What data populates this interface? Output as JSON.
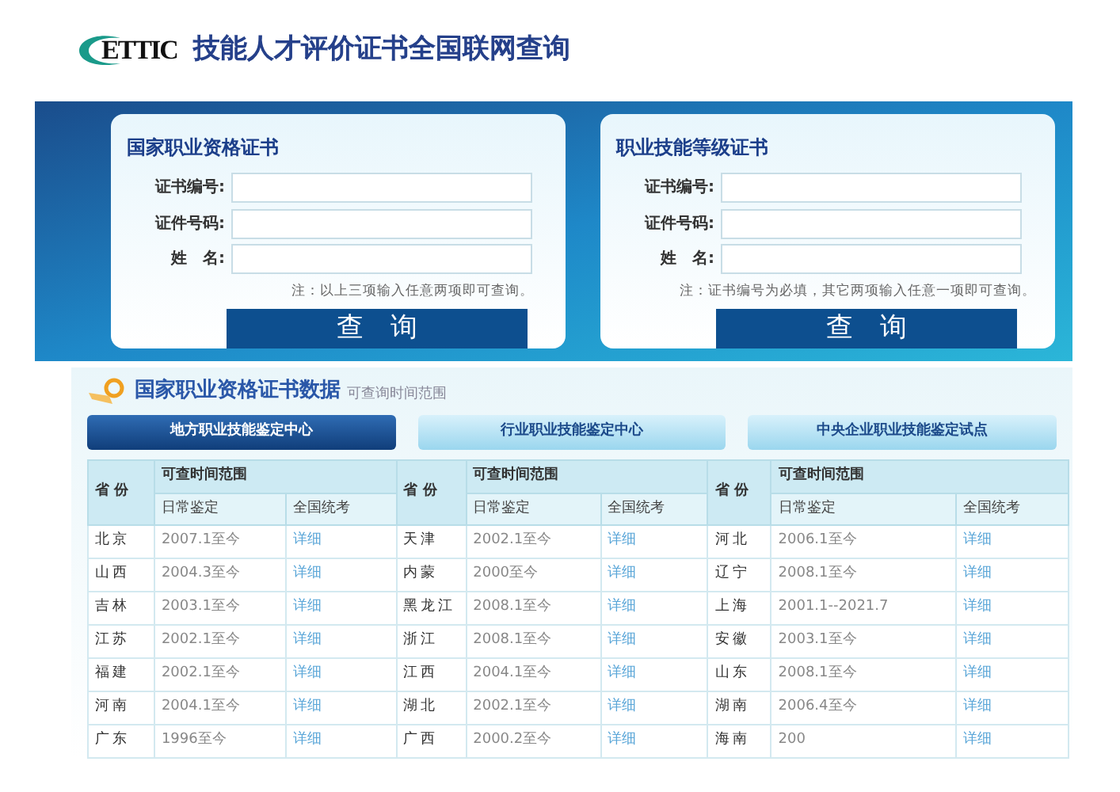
{
  "header": {
    "logo": "ETTIC",
    "title": "技能人才评价证书全国联网查询"
  },
  "query_forms": [
    {
      "title": "国家职业资格证书",
      "fields": [
        {
          "label": "证书编号:"
        },
        {
          "label": "证件号码:"
        },
        {
          "label": "姓　名:"
        }
      ],
      "note": "注：以上三项输入任意两项即可查询。",
      "button": "查　询"
    },
    {
      "title": "职业技能等级证书",
      "fields": [
        {
          "label": "证书编号:"
        },
        {
          "label": "证件号码:"
        },
        {
          "label": "姓　名:"
        }
      ],
      "note": "注：证书编号为必填，其它两项输入任意一项即可查询。",
      "button": "查　询"
    }
  ],
  "data_section": {
    "title": "国家职业资格证书数据",
    "subtitle": "可查询时间范围",
    "tabs": [
      {
        "label": "地方职业技能鉴定中心",
        "selected": true
      },
      {
        "label": "行业职业技能鉴定中心",
        "selected": false
      },
      {
        "label": "中央企业职业技能鉴定试点",
        "selected": false
      }
    ],
    "table": {
      "header_groups": [
        {
          "province_header": "省 份",
          "range_header": "可查时间范围",
          "daily_header": "日常鉴定",
          "national_header": "全国统考"
        },
        {
          "province_header": "省 份",
          "range_header": "可查时间范围",
          "daily_header": "日常鉴定",
          "national_header": "全国统考"
        },
        {
          "province_header": "省 份",
          "range_header": "可查时间范围",
          "daily_header": "日常鉴定",
          "national_header": "全国统考"
        }
      ],
      "rows": [
        [
          {
            "province": "北京",
            "daily": "2007.1至今",
            "national": "详细"
          },
          {
            "province": "天津",
            "daily": "2002.1至今",
            "national": "详细"
          },
          {
            "province": "河北",
            "daily": "2006.1至今",
            "national": "详细"
          }
        ],
        [
          {
            "province": "山西",
            "daily": "2004.3至今",
            "national": "详细"
          },
          {
            "province": "内蒙",
            "daily": "2000至今",
            "national": "详细"
          },
          {
            "province": "辽宁",
            "daily": "2008.1至今",
            "national": "详细"
          }
        ],
        [
          {
            "province": "吉林",
            "daily": "2003.1至今",
            "national": "详细"
          },
          {
            "province": "黑龙江",
            "daily": "2008.1至今",
            "national": "详细"
          },
          {
            "province": "上海",
            "daily": "2001.1--2021.7",
            "national": "详细"
          }
        ],
        [
          {
            "province": "江苏",
            "daily": "2002.1至今",
            "national": "详细"
          },
          {
            "province": "浙江",
            "daily": "2008.1至今",
            "national": "详细"
          },
          {
            "province": "安徽",
            "daily": "2003.1至今",
            "national": "详细"
          }
        ],
        [
          {
            "province": "福建",
            "daily": "2002.1至今",
            "national": "详细"
          },
          {
            "province": "江西",
            "daily": "2004.1至今",
            "national": "详细"
          },
          {
            "province": "山东",
            "daily": "2008.1至今",
            "national": "详细"
          }
        ],
        [
          {
            "province": "河南",
            "daily": "2004.1至今",
            "national": "详细"
          },
          {
            "province": "湖北",
            "daily": "2002.1至今",
            "national": "详细"
          },
          {
            "province": "湖南",
            "daily": "2006.4至今",
            "national": "详细"
          }
        ],
        [
          {
            "province": "广东",
            "daily": "1996至今",
            "national": "详细"
          },
          {
            "province": "广西",
            "daily": "2000.2至今",
            "national": "详细"
          },
          {
            "province": "海南",
            "daily": "200",
            "national": "详细"
          }
        ]
      ]
    }
  }
}
